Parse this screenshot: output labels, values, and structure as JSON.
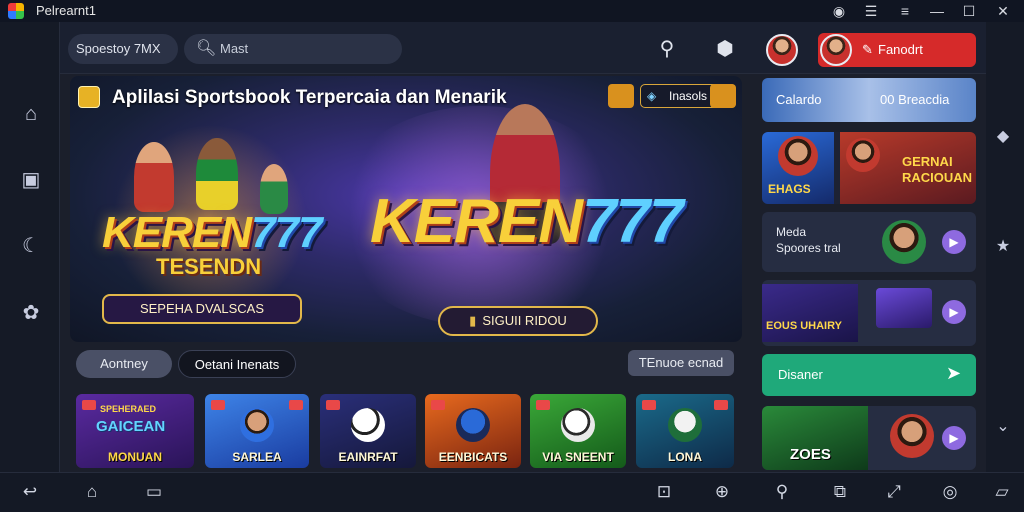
{
  "window": {
    "title": "Pelrearnt1"
  },
  "header": {
    "brand": "Spoestoy 7MX",
    "search_placeholder": "Mast",
    "cta_label": "Fanodrt"
  },
  "hero": {
    "title": "Aplilasi Sportsbook Terpercaia dan Menarik",
    "chip_label": "Inasols",
    "brand_left": "KEREN",
    "brand_left_num": "777",
    "brand_left_sub": "TESENDN",
    "left_button": "SEPEHA DVALSCAS",
    "brand_center": "KEREN",
    "brand_center_num": "777",
    "center_button": "SIGUII RIDOU"
  },
  "strip": {
    "btn1": "Aontney",
    "btn2": "Oetani Inenats",
    "btn3": "TEnuoe ecnad"
  },
  "tiles": [
    {
      "top_text": "SPEHERAED",
      "mid_text": "GAICEAN",
      "label": "MONUAN"
    },
    {
      "label": "SARLEA"
    },
    {
      "label": "EAINRFAT"
    },
    {
      "label": "EENBICATS"
    },
    {
      "label": "VIA SNEENT"
    },
    {
      "label": "LONA"
    }
  ],
  "side": {
    "card1": {
      "left": "Calardo",
      "right": "00 Breacdia"
    },
    "card2": {
      "left": "EHAGS",
      "right_line1": "GERNAI",
      "right_line2": "RACIOUAN"
    },
    "card3": {
      "line1": "Meda",
      "line2": "Spoores tral"
    },
    "card4": {
      "label": "EOUS UHAIRY"
    },
    "card5": {
      "label": "Disaner"
    },
    "card6": {
      "label": "ZOES"
    }
  },
  "colors": {
    "cta": "#d62a2a",
    "accent_green": "#1fa97a",
    "gold": "#e2b84a",
    "play": "#8e6ae0"
  }
}
